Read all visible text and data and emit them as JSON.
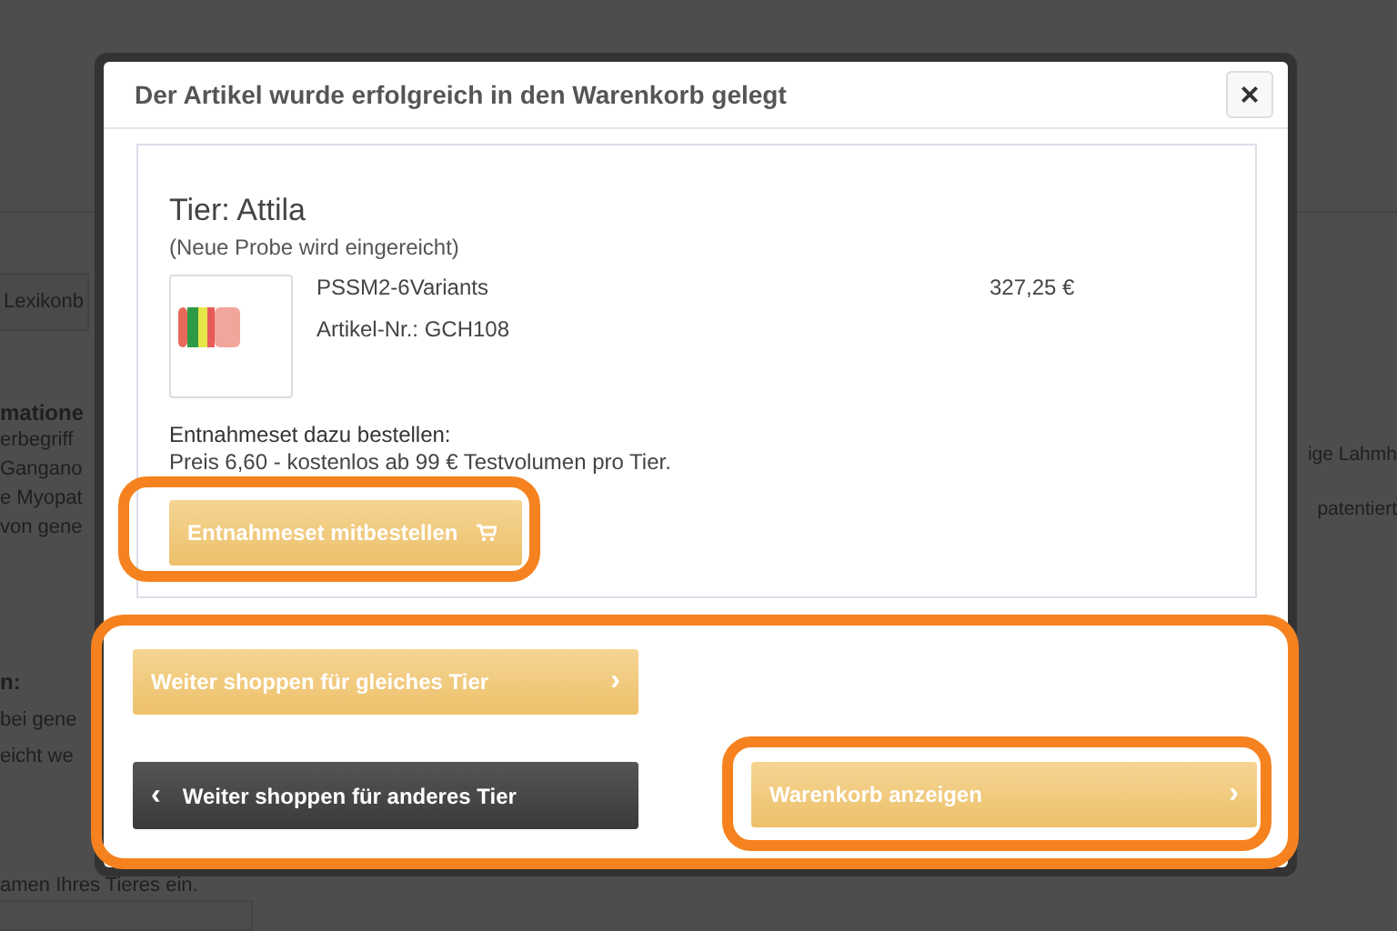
{
  "background": {
    "tab": "Lexikonb",
    "heading": "matione",
    "left_lines": [
      "erbegriff",
      "Gangano",
      "e Myopat",
      "von gene"
    ],
    "right_lines": [
      "ige Lahmh",
      "patentiert"
    ],
    "subheading": "n:",
    "left_lines_2": [
      "bei gene",
      "eicht we"
    ],
    "prompt": "amen Ihres Tieres ein."
  },
  "modal": {
    "title": "Der Artikel wurde erfolgreich in den Warenkorb gelegt",
    "close": "×",
    "animal": "Tier: Attila",
    "note": "(Neue Probe wird eingereicht)",
    "product": {
      "name": "PSSM2-6Variants",
      "article": "Artikel-Nr.: GCH108",
      "price": "327,25 €"
    },
    "kit_heading": "Entnahmeset dazu bestellen:",
    "kit_text": "Preis 6,60 - kostenlos ab 99 € Testvolumen pro Tier.",
    "kit_button": "Entnahmeset mitbestellen",
    "buttons": [
      {
        "label": "Weiter shoppen für gleiches Tier",
        "kind": "light",
        "icon": "›"
      },
      {
        "label": "Weiter shoppen für anderes Tier",
        "kind": "dark",
        "icon": "‹"
      },
      {
        "label": "Warenkorb anzeigen",
        "kind": "light",
        "icon": "›"
      }
    ]
  }
}
